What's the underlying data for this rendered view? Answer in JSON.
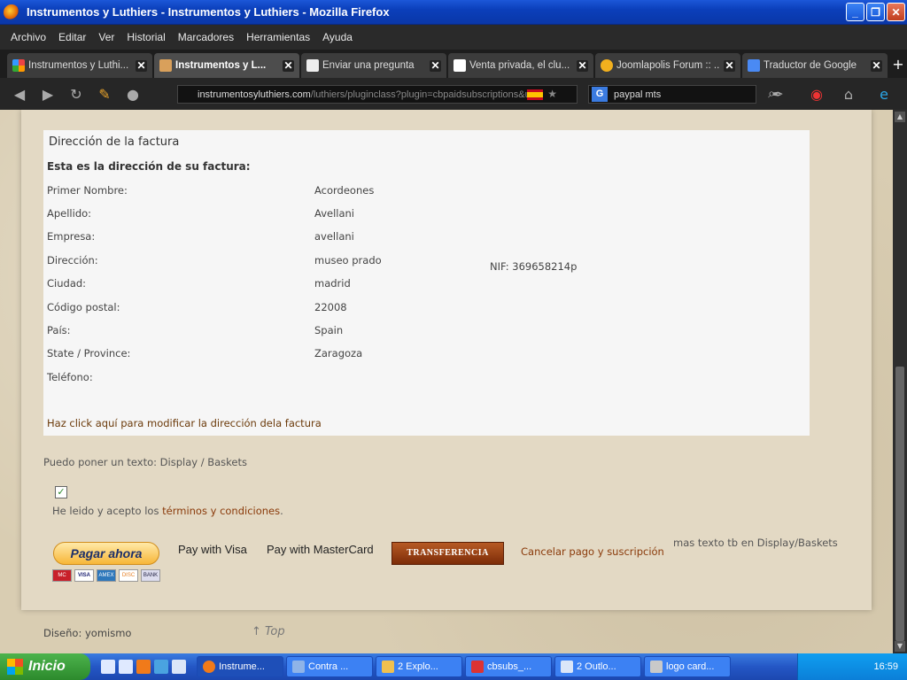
{
  "window": {
    "title": "Instrumentos y Luthiers - Instrumentos y Luthiers - Mozilla Firefox",
    "controls": {
      "minimize": "_",
      "maximize": "❐",
      "close": "✕"
    }
  },
  "menu": [
    "Archivo",
    "Editar",
    "Ver",
    "Historial",
    "Marcadores",
    "Herramientas",
    "Ayuda"
  ],
  "tabs": [
    {
      "label": "Instrumentos y Luthi...",
      "active": false,
      "icon": "joomla-icon"
    },
    {
      "label": "Instrumentos y L...",
      "active": true,
      "icon": "guitar-icon"
    },
    {
      "label": "Enviar una pregunta",
      "active": false,
      "icon": "page-icon"
    },
    {
      "label": "Venta privada, el clu...",
      "active": false,
      "icon": "privalia-icon"
    },
    {
      "label": "Joomlapolis Forum :: ...",
      "active": false,
      "icon": "joomlapolis-icon"
    },
    {
      "label": "Traductor de Google",
      "active": false,
      "icon": "translate-icon"
    }
  ],
  "nav": {
    "url_host": "instrumentosyluthiers.com",
    "url_path": "/luthiers/pluginclass?plugin=cbpaidsubscriptions&u",
    "search_value": "paypal mts",
    "search_engine": "G"
  },
  "billing": {
    "title": "Dirección de la factura",
    "subtitle": "Esta es la dirección de su factura:",
    "fields": [
      {
        "label": "Primer Nombre:",
        "value": "Acordeones"
      },
      {
        "label": "Apellido:",
        "value": "Avellani"
      },
      {
        "label": "Empresa:",
        "value": "avellani"
      },
      {
        "label": "Dirección:",
        "value": "museo prado"
      },
      {
        "label": "Ciudad:",
        "value": "madrid"
      },
      {
        "label": "Código postal:",
        "value": "22008"
      },
      {
        "label": "País:",
        "value": "Spain"
      },
      {
        "label": "State / Province:",
        "value": "Zaragoza"
      },
      {
        "label": "Teléfono:",
        "value": ""
      }
    ],
    "nif": "NIF:  369658214p",
    "edit_link": "Haz click aquí para modificar la dirección dela factura"
  },
  "note_text": "Puedo poner un texto: Display / Baskets",
  "terms": {
    "prefix": "He leido y acepto los ",
    "link": "términos y condiciones",
    "suffix": ".",
    "checked": true
  },
  "payment": {
    "paypal_button": "Pagar ahora",
    "cards": [
      "MC",
      "VISA",
      "AMEX",
      "DISC",
      "BANK"
    ],
    "visa_label": "Pay with Visa",
    "mastercard_label": "Pay with MasterCard",
    "transfer_button": "TRANSFERENCIA",
    "cancel_link": "Cancelar pago y suscripción",
    "more_text": "mas texto tb en Display/Baskets"
  },
  "footer": {
    "design": "Diseño: yomismo",
    "top_link": "↑ Top"
  },
  "taskbar": {
    "start": "Inicio",
    "items": [
      {
        "label": "Instrume...",
        "active": true
      },
      {
        "label": "Contra ...",
        "active": false
      },
      {
        "label": "2 Explo...",
        "active": false
      },
      {
        "label": "cbsubs_...",
        "active": false
      },
      {
        "label": "2 Outlo...",
        "active": false
      },
      {
        "label": "logo card...",
        "active": false
      }
    ],
    "clock": "16:59"
  }
}
